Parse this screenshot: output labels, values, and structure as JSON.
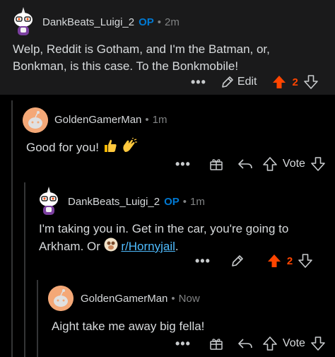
{
  "comments": [
    {
      "username": "DankBeats_Luigi_2",
      "op_badge": "OP",
      "separator": "•",
      "time": "2m",
      "text": "Welp, Reddit is Gotham, and I'm the Batman, or, Bonkman, is this case. To the Bonkmobile!",
      "actions": {
        "more": "•••",
        "edit": "Edit",
        "score": "2",
        "upvoted": true
      }
    },
    {
      "username": "GoldenGamerMan",
      "separator": "•",
      "time": "1m",
      "text": "Good for you!",
      "emojis": [
        "thumbs-up",
        "clapping-hands"
      ],
      "actions": {
        "more": "•••",
        "vote": "Vote"
      }
    },
    {
      "username": "DankBeats_Luigi_2",
      "op_badge": "OP",
      "separator": "•",
      "time": "1m",
      "text_before": "I'm taking you in. Get in the car, you're going to Arkham. Or",
      "subreddit": "r/Hornyjail",
      "text_after": ".",
      "actions": {
        "more": "•••",
        "score": "2",
        "upvoted": true
      }
    },
    {
      "username": "GoldenGamerMan",
      "separator": "•",
      "time": "Now",
      "text": "Aight take me away big fella!",
      "actions": {
        "more": "•••",
        "vote": "Vote"
      }
    }
  ],
  "colors": {
    "upvote": "#ff4500",
    "op": "#0079d3",
    "link": "#4fbcff"
  }
}
